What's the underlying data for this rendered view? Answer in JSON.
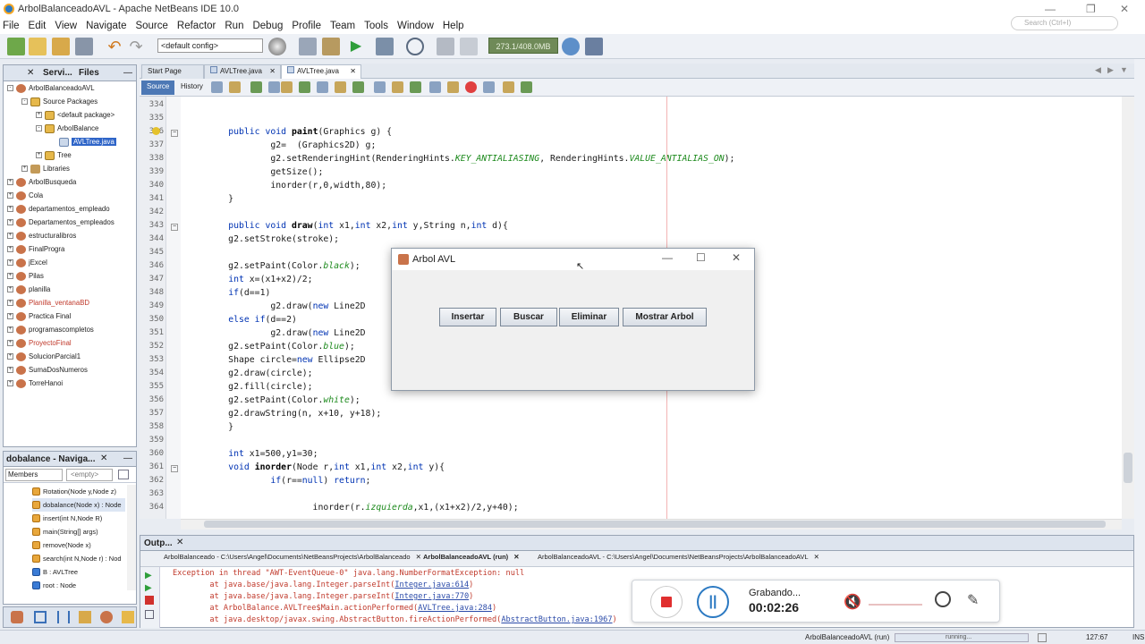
{
  "window": {
    "title": "ArbolBalanceadoAVL - Apache NetBeans IDE 10.0"
  },
  "menu": [
    "File",
    "Edit",
    "View",
    "Navigate",
    "Source",
    "Refactor",
    "Run",
    "Debug",
    "Profile",
    "Team",
    "Tools",
    "Window",
    "Help"
  ],
  "toolbar": {
    "config": "<default config>",
    "memory": "273.1/408.0MB",
    "search_placeholder": "Search (Ctrl+I)"
  },
  "projects": {
    "tabs": [
      "Servi...",
      "Files"
    ],
    "rows": [
      {
        "label": "ArbolBalanceadoAVL",
        "icon": "project-icon",
        "indent": 0,
        "exp": "-",
        "red": false
      },
      {
        "label": "Source Packages",
        "icon": "package-folder-icon",
        "indent": 1,
        "exp": "-",
        "red": false
      },
      {
        "label": "<default package>",
        "icon": "package-icon",
        "indent": 2,
        "exp": "+",
        "red": false
      },
      {
        "label": "ArbolBalance",
        "icon": "package-icon",
        "indent": 2,
        "exp": "-",
        "red": false
      },
      {
        "label": "AVLTree.java",
        "icon": "java-file-icon",
        "indent": 3,
        "exp": "",
        "red": false,
        "selected": true
      },
      {
        "label": "Tree",
        "icon": "package-icon",
        "indent": 2,
        "exp": "+",
        "red": false
      },
      {
        "label": "Libraries",
        "icon": "library-icon",
        "indent": 1,
        "exp": "+",
        "red": false
      },
      {
        "label": "ArbolBusqueda",
        "icon": "project-icon",
        "indent": 0,
        "exp": "+",
        "red": false
      },
      {
        "label": "Cola",
        "icon": "project-icon",
        "indent": 0,
        "exp": "+",
        "red": false
      },
      {
        "label": "departamentos_empleado",
        "icon": "project-icon",
        "indent": 0,
        "exp": "+",
        "red": false
      },
      {
        "label": "Departamentos_empleados",
        "icon": "project-icon",
        "indent": 0,
        "exp": "+",
        "red": false
      },
      {
        "label": "estructuralibros",
        "icon": "project-icon",
        "indent": 0,
        "exp": "+",
        "red": false
      },
      {
        "label": "FinalProgra",
        "icon": "project-icon",
        "indent": 0,
        "exp": "+",
        "red": false
      },
      {
        "label": "jExcel",
        "icon": "project-icon",
        "indent": 0,
        "exp": "+",
        "red": false
      },
      {
        "label": "Pilas",
        "icon": "project-icon",
        "indent": 0,
        "exp": "+",
        "red": false
      },
      {
        "label": "planilla",
        "icon": "project-icon",
        "indent": 0,
        "exp": "+",
        "red": false
      },
      {
        "label": "Planilla_ventanaBD",
        "icon": "project-icon",
        "indent": 0,
        "exp": "+",
        "red": true
      },
      {
        "label": "Practica Final",
        "icon": "project-icon",
        "indent": 0,
        "exp": "+",
        "red": false
      },
      {
        "label": "programascompletos",
        "icon": "project-icon",
        "indent": 0,
        "exp": "+",
        "red": false
      },
      {
        "label": "ProyectoFinal",
        "icon": "project-icon",
        "indent": 0,
        "exp": "+",
        "red": true
      },
      {
        "label": "SolucionParcial1",
        "icon": "project-icon",
        "indent": 0,
        "exp": "+",
        "red": false
      },
      {
        "label": "SumaDosNumeros",
        "icon": "project-icon",
        "indent": 0,
        "exp": "+",
        "red": false
      },
      {
        "label": "TorreHanoi",
        "icon": "project-icon",
        "indent": 0,
        "exp": "+",
        "red": false
      }
    ]
  },
  "navigator": {
    "title": "dobalance - Naviga...",
    "members_label": "Members",
    "filter_value": "<empty>",
    "items": [
      "Rotation(Node y,Node z)",
      "dobalance(Node x) : Node",
      "insert(int N,Node R)",
      "main(String[] args)",
      "remove(Node x)",
      "search(int N,Node r) : Nod",
      "B : AVLTree",
      "root : Node"
    ]
  },
  "editor": {
    "tabs": [
      "Start Page",
      "AVLTree.java",
      "AVLTree.java"
    ],
    "source_label": "Source",
    "history_label": "History",
    "line_numbers": [
      "334",
      "335",
      "336",
      "337",
      "338",
      "339",
      "340",
      "341",
      "342",
      "343",
      "344",
      "345",
      "346",
      "347",
      "348",
      "349",
      "350",
      "351",
      "352",
      "353",
      "354",
      "355",
      "356",
      "357",
      "358",
      "359",
      "360",
      "361",
      "362",
      "363",
      "364"
    ],
    "lines": [
      "",
      "",
      "        <k>public void</k> <b>paint</b>(Graphics g) {",
      "                g2=  (Graphics2D) g;",
      "                g2.setRenderingHint(RenderingHints.<i>KEY_ANTIALIASING</i>, RenderingHints.<i>VALUE_ANTIALIAS_ON</i>);",
      "                getSize();",
      "                inorder(r,0,width,80);",
      "        }",
      "",
      "        <k>public void</k> <b>draw</b>(<k>int</k> x1,<k>int</k> x2,<k>int</k> y,String n,<k>int</k> d){",
      "        g2.setStroke(stroke);",
      "",
      "        g2.setPaint(Color.<i>black</i>);",
      "        <k>int</k> x=(x1+x2)/2;",
      "        <k>if</k>(d==1)",
      "                g2.draw(<k>new</k> Line2D",
      "        <k>else if</k>(d==2)",
      "                g2.draw(<k>new</k> Line2D",
      "        g2.setPaint(Color.<i>blue</i>);",
      "        Shape circle=<k>new</k> Ellipse2D",
      "        g2.draw(circle);",
      "        g2.fill(circle);",
      "        g2.setPaint(Color.<i>white</i>);",
      "        g2.drawString(n, x+10, y+18);",
      "        }",
      "",
      "        <k>int</k> x1=500,y1=30;",
      "        <k>void</k> <b>inorder</b>(Node r,<k>int</k> x1,<k>int</k> x2,<k>int</k> y){",
      "                <k>if</k>(r==<k>null</k>) <k>return</k>;",
      "",
      "                        inorder(r.<i>izquierda</i>,x1,(x1+x2)/2,y+40);"
    ]
  },
  "output": {
    "title": "Outp...",
    "tabs": [
      "ArbolBalanceado - C:\\Users\\Angel\\Documents\\NetBeansProjects\\ArbolBalanceado",
      "ArbolBalanceadoAVL (run)",
      "ArbolBalanceadoAVL - C:\\Users\\Angel\\Documents\\NetBeansProjects\\ArbolBalanceadoAVL"
    ],
    "lines": [
      {
        "text": "Exception in thread \"AWT-EventQueue-0\" java.lang.NumberFormatException: null",
        "link": ""
      },
      {
        "text": "        at java.base/java.lang.Integer.parseInt(",
        "link": "Integer.java:614",
        "end": ")"
      },
      {
        "text": "        at java.base/java.lang.Integer.parseInt(",
        "link": "Integer.java:770",
        "end": ")"
      },
      {
        "text": "        at ArbolBalance.AVLTree$Main.actionPerformed(",
        "link": "AVLTree.java:284",
        "end": ")"
      },
      {
        "text": "        at java.desktop/javax.swing.AbstractButton.fireActionPerformed(",
        "link": "AbstractButton.java:1967",
        "end": ")"
      }
    ]
  },
  "dialog": {
    "title": "Arbol AVL",
    "buttons": [
      "Insertar",
      "Buscar",
      "Eliminar",
      "Mostrar Arbol"
    ]
  },
  "recorder": {
    "status": "Grabando...",
    "time": "00:02:26"
  },
  "status": {
    "project": "ArbolBalanceadoAVL (run)",
    "progress_label": "running...",
    "position": "127:67",
    "mode": "INS"
  },
  "colors": {
    "keyword": "#0033b3",
    "error": "#c0392b",
    "accent": "#2b79c2"
  }
}
